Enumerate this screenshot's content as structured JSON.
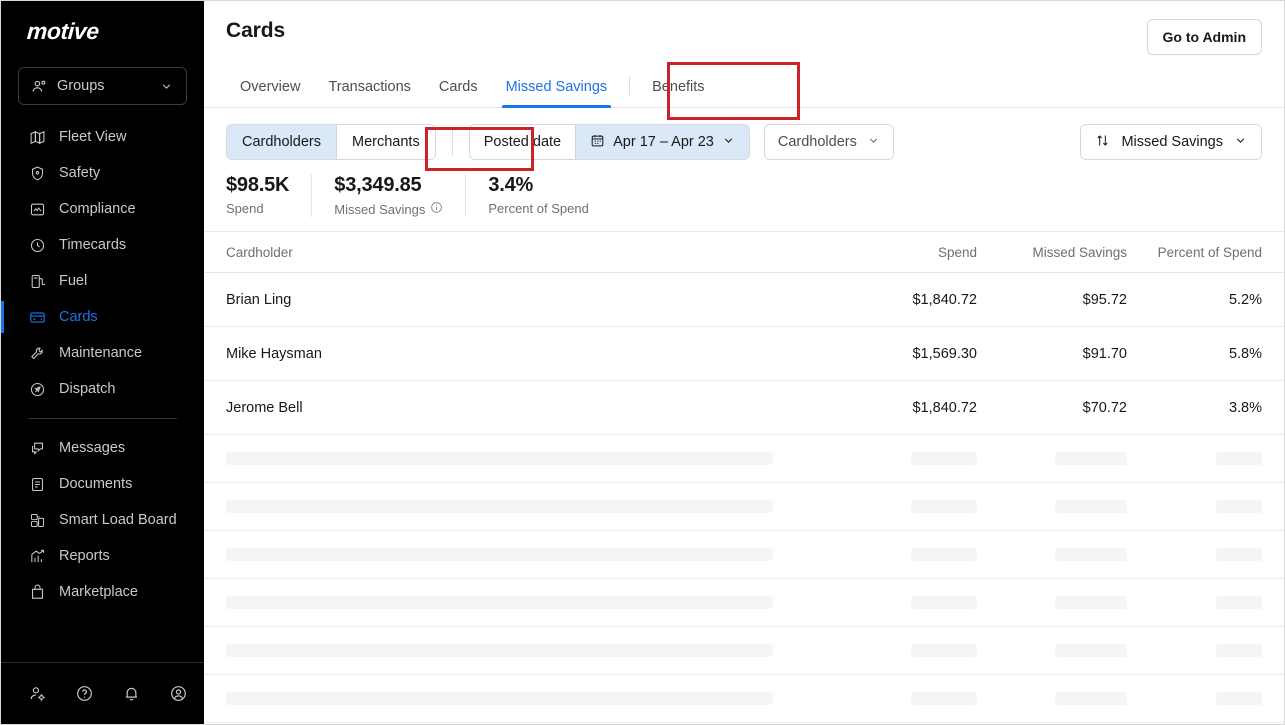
{
  "sidebar": {
    "brand": "motive",
    "groups_selector": {
      "label": "Groups",
      "icon": "groups-icon",
      "chevron": "chevron-down-icon"
    },
    "items": [
      {
        "label": "Fleet View",
        "icon": "map-icon",
        "active": false
      },
      {
        "label": "Safety",
        "icon": "shield-icon",
        "active": false
      },
      {
        "label": "Compliance",
        "icon": "compliance-icon",
        "active": false
      },
      {
        "label": "Timecards",
        "icon": "clock-icon",
        "active": false
      },
      {
        "label": "Fuel",
        "icon": "fuel-pump-icon",
        "active": false
      },
      {
        "label": "Cards",
        "icon": "credit-card-icon",
        "active": true
      },
      {
        "label": "Maintenance",
        "icon": "wrench-icon",
        "active": false
      },
      {
        "label": "Dispatch",
        "icon": "dispatch-icon",
        "active": false
      }
    ],
    "items_secondary": [
      {
        "label": "Messages",
        "icon": "messages-icon",
        "active": false
      },
      {
        "label": "Documents",
        "icon": "document-icon",
        "active": false
      },
      {
        "label": "Smart Load Board",
        "icon": "load-board-icon",
        "active": false
      },
      {
        "label": "Reports",
        "icon": "reports-chart-icon",
        "active": false
      },
      {
        "label": "Marketplace",
        "icon": "marketplace-bag-icon",
        "active": false
      }
    ],
    "footer_icons": [
      "user-settings-icon",
      "help-circle-icon",
      "bell-icon",
      "account-circle-icon"
    ],
    "active_color": "#1a73e8"
  },
  "header": {
    "title": "Cards",
    "admin_button": "Go to Admin"
  },
  "tabs": {
    "items": [
      {
        "label": "Overview",
        "active": false
      },
      {
        "label": "Transactions",
        "active": false
      },
      {
        "label": "Cards",
        "active": false
      },
      {
        "label": "Missed Savings",
        "active": true
      },
      {
        "label": "Benefits",
        "active": false
      }
    ],
    "active_color": "#1a73e8"
  },
  "filters": {
    "segment": [
      {
        "label": "Cardholders",
        "active": true
      },
      {
        "label": "Merchants",
        "active": false
      }
    ],
    "date_label": "Posted date",
    "date_range": "Apr 17 – Apr 23",
    "date_icon": "calendar-icon",
    "cardholders_dropdown": "Cardholders",
    "sort_label": "Missed Savings",
    "sort_icon": "sort-arrows-icon",
    "highlight_color": "#dbe8f7"
  },
  "stats": [
    {
      "value": "$98.5K",
      "label": "Spend",
      "info": false
    },
    {
      "value": "$3,349.85",
      "label": "Missed Savings",
      "info": true
    },
    {
      "value": "3.4%",
      "label": "Percent of Spend",
      "info": false
    }
  ],
  "table": {
    "columns": [
      "Cardholder",
      "Spend",
      "Missed Savings",
      "Percent of Spend"
    ],
    "rows": [
      {
        "name": "Brian Ling",
        "spend": "$1,840.72",
        "missed": "$95.72",
        "pct": "5.2%"
      },
      {
        "name": "Mike Haysman",
        "spend": "$1,569.30",
        "missed": "$91.70",
        "pct": "5.8%"
      },
      {
        "name": "Jerome Bell",
        "spend": "$1,840.72",
        "missed": "$70.72",
        "pct": "3.8%"
      }
    ],
    "skeleton_row_count": 6
  },
  "annotations": {
    "color": "#cc2229",
    "boxes": [
      "missed-savings-tab",
      "cardholders-toggle"
    ]
  }
}
